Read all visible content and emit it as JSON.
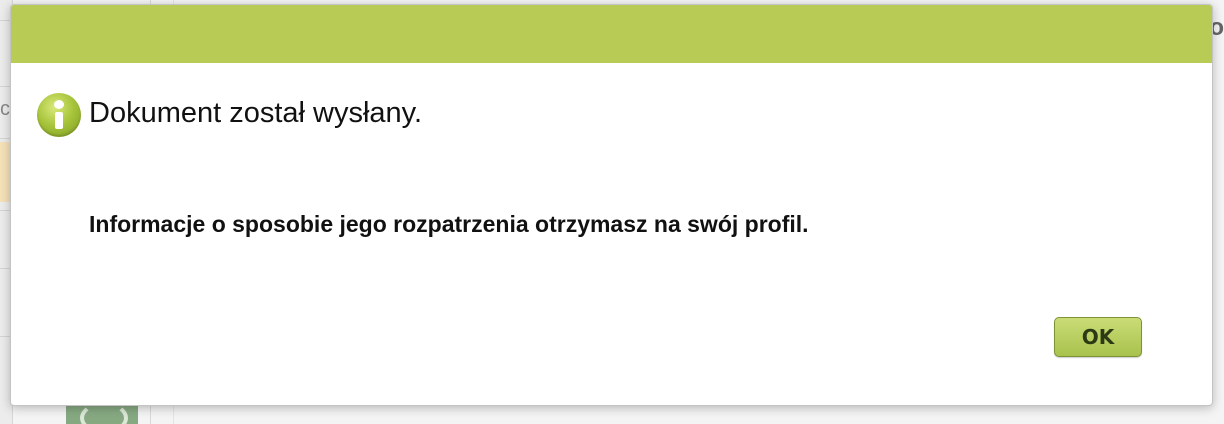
{
  "background": {
    "left_fragment_char": "c",
    "right_fragment_char": "o"
  },
  "dialog": {
    "header_color": "#b7cb55",
    "icon": "info-icon",
    "title": "Dokument został wysłany.",
    "message": "Informacje o sposobie jego rozpatrzenia otrzymasz na swój profil.",
    "ok_label": "OK"
  }
}
